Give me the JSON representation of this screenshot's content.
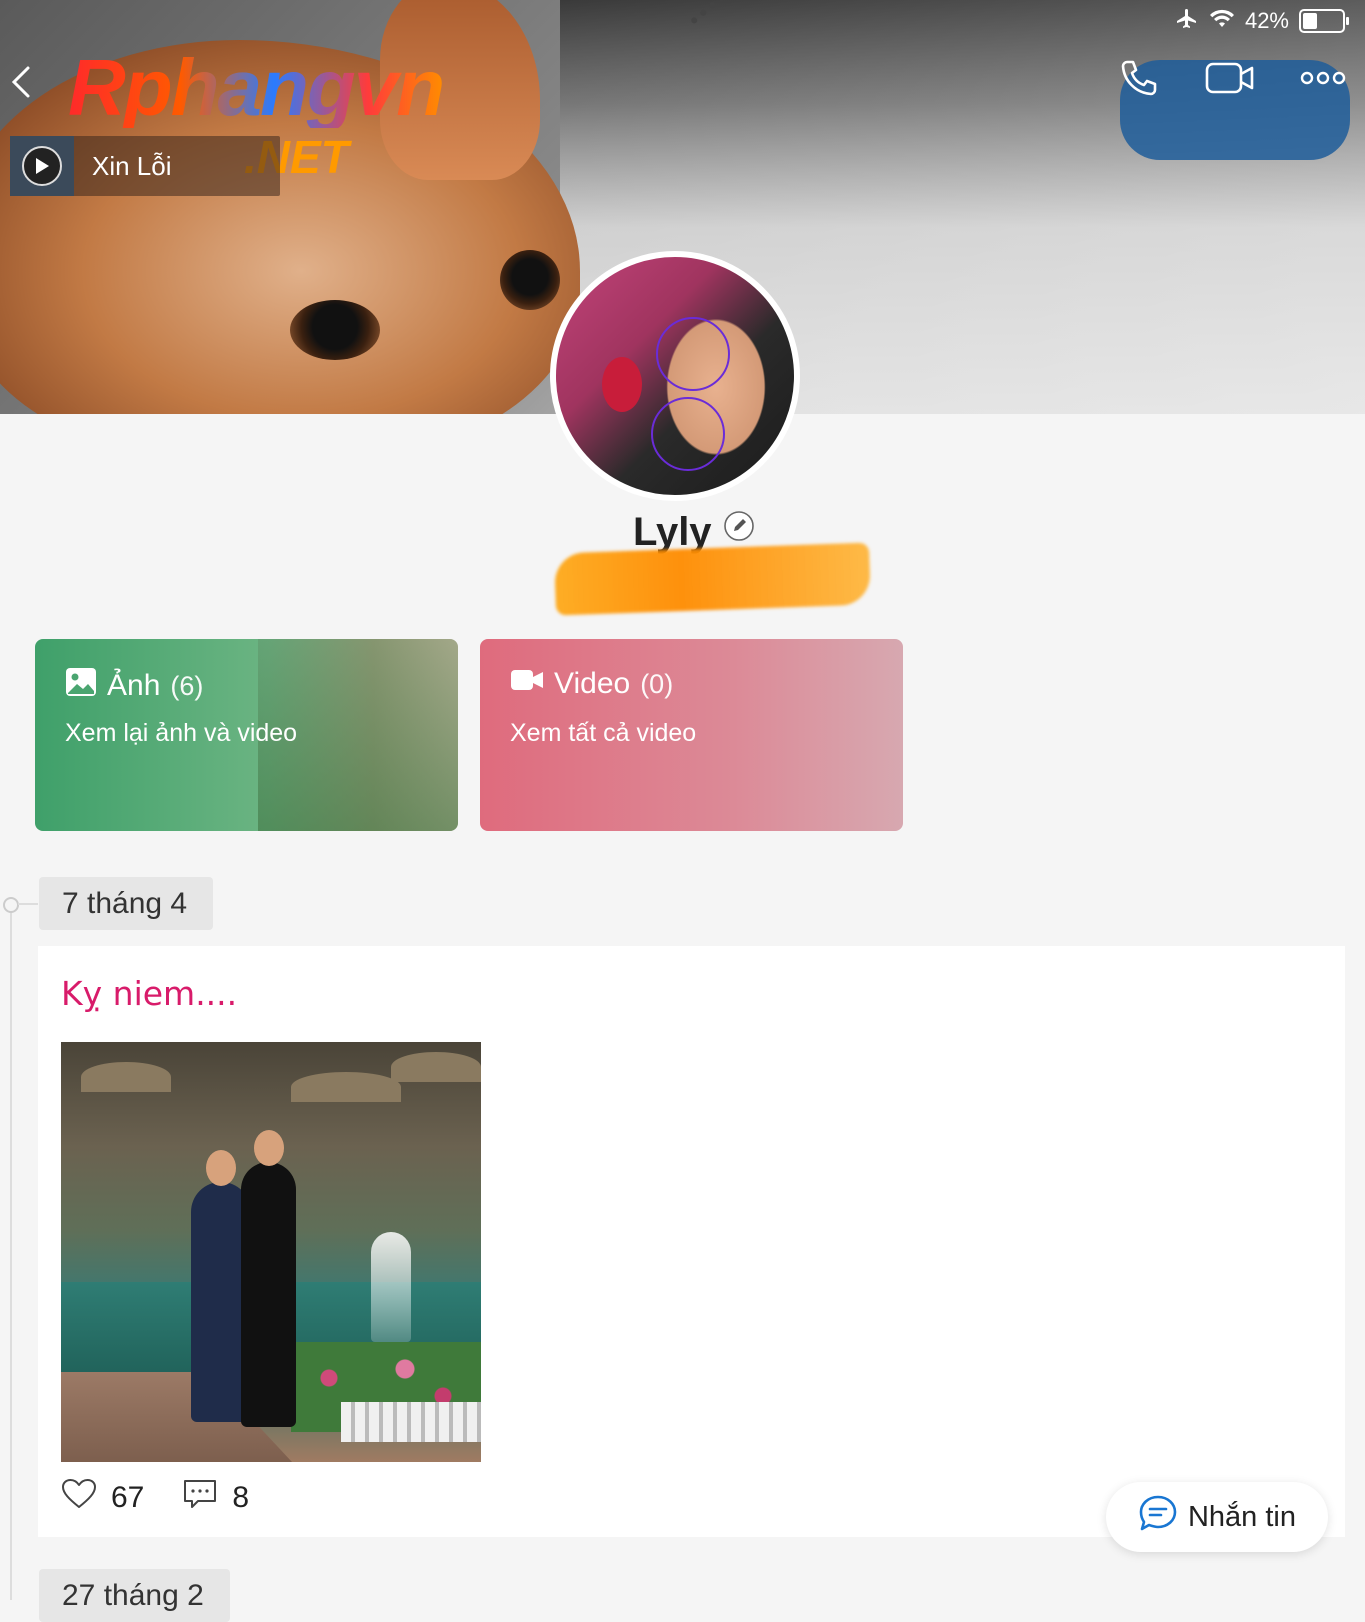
{
  "status_bar": {
    "battery": "42%",
    "battery_level": 0.42,
    "icons": [
      "airplane-icon",
      "wifi-icon",
      "battery-icon"
    ]
  },
  "header": {
    "watermark_main": "Rphangvn",
    "watermark_sub": ".NET",
    "song_title": "Xin Lỗi",
    "song_thumb_text": "Xin Lỗi",
    "icons": [
      "back-icon",
      "phone-icon",
      "video-call-icon",
      "more-icon"
    ]
  },
  "profile": {
    "name": "Lyly"
  },
  "cards": {
    "photos": {
      "title": "Ảnh",
      "count": "(6)",
      "subtitle": "Xem lại ảnh và video"
    },
    "videos": {
      "title": "Video",
      "count": "(0)",
      "subtitle": "Xem tất cả video"
    }
  },
  "timeline": {
    "dates": [
      "7 tháng 4",
      "27 tháng 2"
    ],
    "post": {
      "caption": "Kỵ niem....",
      "likes": "67",
      "comments": "8"
    }
  },
  "message_button": {
    "label": "Nhắn tin"
  },
  "colors": {
    "caption_pink": "#d81b6a",
    "photo_card_green": "#3fa06a",
    "video_card_pink": "#df6b7d",
    "message_icon_blue": "#1976d2"
  }
}
